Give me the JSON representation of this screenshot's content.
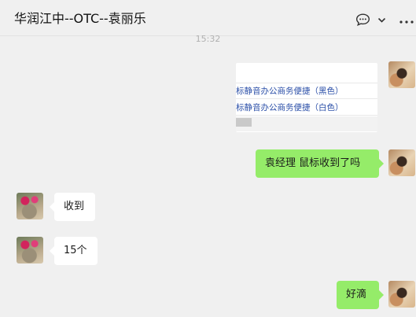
{
  "header": {
    "title": "华润江中--OTC--袁丽乐",
    "icons": [
      "chat-bubble-icon",
      "chevron-down-icon",
      "more-icon"
    ]
  },
  "timestamp": "15:32",
  "product_card": {
    "lines": [
      "标静音办公商务便捷（黑色）",
      "标静音办公商务便捷（白色）"
    ]
  },
  "messages": [
    {
      "side": "right",
      "text": "袁经理 鼠标收到了吗"
    },
    {
      "side": "left",
      "text": "收到"
    },
    {
      "side": "left",
      "text": "15个"
    },
    {
      "side": "right",
      "text": "好滴"
    }
  ],
  "colors": {
    "background": "#f0f0f0",
    "self_bubble": "#95ec69",
    "other_bubble": "#ffffff",
    "link_text": "#2b4fa8"
  }
}
